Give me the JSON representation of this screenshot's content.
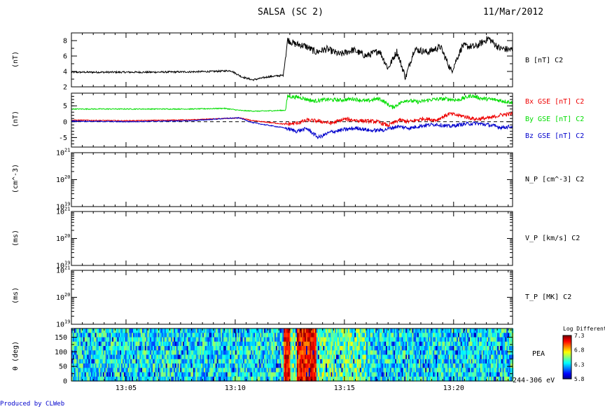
{
  "header": {
    "title": "SALSA (SC 2)",
    "date": "11/Mar/2012"
  },
  "credit": "Produced by CLWeb",
  "colors": {
    "bx": "#ee0000",
    "by": "#00dd00",
    "bz": "#0000cc",
    "trace": "#000000"
  },
  "time_axis": {
    "ticks": [
      "13:05",
      "13:10",
      "13:15",
      "13:20"
    ],
    "range_min": [
      2.5,
      22.7
    ]
  },
  "chart_data": [
    {
      "type": "line",
      "ylabel": "(nT)",
      "ylim": [
        2,
        9
      ],
      "yticks": [
        "2",
        "4",
        "6",
        "8"
      ],
      "series": [
        {
          "name": "B [nT] C2",
          "color": "#000000",
          "x": [
            2.5,
            4,
            6,
            8,
            9,
            9.8,
            10.3,
            10.8,
            11.5,
            12.2,
            12.4,
            12.7,
            13.2,
            13.7,
            14.2,
            14.8,
            15.4,
            16,
            16.6,
            17,
            17.4,
            17.8,
            18.2,
            18.8,
            19.4,
            19.9,
            20.4,
            21,
            21.6,
            22.1,
            22.7
          ],
          "values": [
            3.9,
            3.9,
            3.9,
            3.95,
            4.0,
            4.1,
            3.3,
            2.9,
            3.3,
            3.5,
            8.1,
            7.6,
            7.3,
            6.5,
            6.9,
            6.2,
            6.8,
            6.0,
            6.7,
            4.4,
            6.6,
            3.2,
            6.9,
            6.5,
            7.2,
            4.0,
            7.3,
            7.2,
            8.3,
            7.0,
            6.8
          ]
        }
      ],
      "legend": [
        "B [nT] C2"
      ]
    },
    {
      "type": "line",
      "ylabel": "(nT)",
      "ylim": [
        -8,
        9
      ],
      "yticks": [
        "-5",
        "0",
        "5"
      ],
      "series": [
        {
          "name": "Bx GSE [nT] C2",
          "color": "#ee0000",
          "x": [
            2.5,
            5,
            8,
            9.5,
            10.2,
            10.8,
            11.5,
            12.3,
            12.8,
            13.3,
            13.8,
            14.4,
            15,
            15.8,
            16.5,
            17,
            17.5,
            18,
            18.6,
            19.2,
            19.8,
            20.4,
            21,
            21.7,
            22.2,
            22.7
          ],
          "values": [
            0.5,
            0.3,
            0.6,
            1.0,
            1.2,
            0.3,
            -0.2,
            -0.8,
            -0.5,
            0.5,
            0.2,
            -0.5,
            0.8,
            0.3,
            0.0,
            -1.2,
            0.5,
            0.0,
            1.0,
            0.5,
            2.5,
            1.8,
            0.8,
            1.2,
            2.2,
            2.5
          ]
        },
        {
          "name": "By GSE [nT] C2",
          "color": "#00dd00",
          "x": [
            2.5,
            5,
            8,
            9.5,
            10.3,
            11,
            12.3,
            12.4,
            13,
            13.6,
            14.2,
            14.8,
            15.4,
            16,
            16.6,
            17.2,
            17.8,
            18.4,
            19,
            19.6,
            20.2,
            20.8,
            21.3,
            21.8,
            22.3,
            22.7
          ],
          "values": [
            4.0,
            4.0,
            4.0,
            4.2,
            3.5,
            3.3,
            3.6,
            8.0,
            7.6,
            6.5,
            7.0,
            6.8,
            7.2,
            6.5,
            7.3,
            4.5,
            6.8,
            6.2,
            7.0,
            7.2,
            6.8,
            8.2,
            7.3,
            7.0,
            6.5,
            6.0
          ]
        },
        {
          "name": "Bz GSE [nT] C2",
          "color": "#0000cc",
          "x": [
            2.5,
            5,
            8,
            9.5,
            10.2,
            10.8,
            11.4,
            12.3,
            12.8,
            13.3,
            13.8,
            14.4,
            15,
            15.6,
            16.2,
            16.8,
            17.4,
            18,
            18.6,
            19.2,
            19.8,
            20.4,
            21,
            21.6,
            22.2,
            22.7
          ],
          "values": [
            0.2,
            0.0,
            0.3,
            1.0,
            1.2,
            -0.3,
            -1.0,
            -2.0,
            -3.0,
            -2.2,
            -5.0,
            -3.2,
            -2.5,
            -2.0,
            -2.8,
            -2.6,
            -1.5,
            -2.0,
            -1.2,
            -0.8,
            -1.5,
            -0.8,
            -0.5,
            -1.0,
            -1.8,
            -1.5
          ]
        }
      ],
      "legend": [
        "Bx GSE [nT] C2",
        "By GSE [nT] C2",
        "Bz GSE [nT] C2"
      ]
    },
    {
      "type": "line",
      "ylabel": "(cm^-3)",
      "scale": "log",
      "yticks_exp": [
        "10^21",
        "10^20",
        "10^19"
      ],
      "series": [],
      "legend": [
        "N_P [cm^-3] C2"
      ]
    },
    {
      "type": "line",
      "ylabel": "(ms)",
      "scale": "log",
      "yticks_exp": [
        "10^21",
        "10^20",
        "10^19"
      ],
      "series": [],
      "legend": [
        "V_P [km/s] C2"
      ]
    },
    {
      "type": "line",
      "ylabel": "(ms)",
      "scale": "log",
      "yticks_exp": [
        "10^21",
        "10^20",
        "10^19"
      ],
      "series": [],
      "legend": [
        "T_P [MK] C2"
      ]
    },
    {
      "type": "heatmap",
      "ylabel": "θ (deg)",
      "ylim": [
        0,
        180
      ],
      "yticks": [
        "0",
        "50",
        "100",
        "150"
      ],
      "label": "PEA",
      "energy_label": "244-306 eV",
      "colorbar": {
        "title": "Log Differential",
        "ticks": [
          "7.3",
          "6.8",
          "6.3",
          "5.8"
        ],
        "min": 5.8,
        "max": 7.3
      },
      "enhanced_intervals_min": [
        [
          12.2,
          12.5
        ],
        [
          12.8,
          13.7
        ]
      ],
      "background_level": 6.35
    }
  ]
}
